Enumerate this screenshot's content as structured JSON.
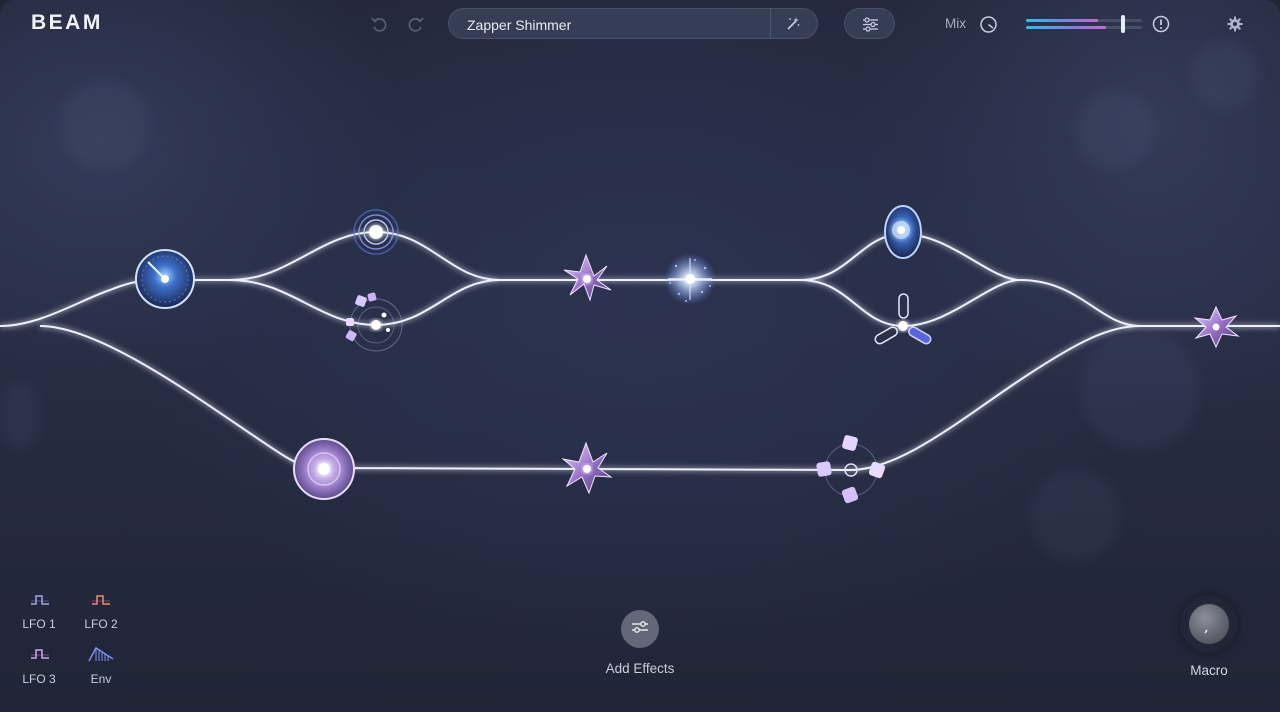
{
  "app": {
    "title": "BEAM"
  },
  "toolbar": {
    "undo_icon": "undo-icon",
    "redo_icon": "redo-icon",
    "preset_name": "Zapper Shimmer",
    "magic_icon": "magic-wand-icon",
    "eq_icon": "sliders-icon",
    "mix_label": "Mix",
    "mix_value": 0.75,
    "alert_icon": "alert-icon",
    "settings_icon": "gear-icon"
  },
  "colors": {
    "accent": "#3ab7e8",
    "accent2": "#b57ad6",
    "line": "#ffffff",
    "background": "#23283c"
  },
  "modulators": [
    {
      "label": "LFO 1",
      "icon": "square-wave-icon",
      "color": "#9fa6e8"
    },
    {
      "label": "LFO 2",
      "icon": "square-wave-icon",
      "color": "#f08a6a"
    },
    {
      "label": "LFO 3",
      "icon": "square-wave-icon",
      "color": "#d4a3e8"
    },
    {
      "label": "Env",
      "icon": "envelope-icon",
      "color": "#7f8ef0"
    }
  ],
  "add_effects": {
    "label": "Add Effects",
    "icon": "sliders-icon"
  },
  "macro": {
    "label": "Macro"
  }
}
